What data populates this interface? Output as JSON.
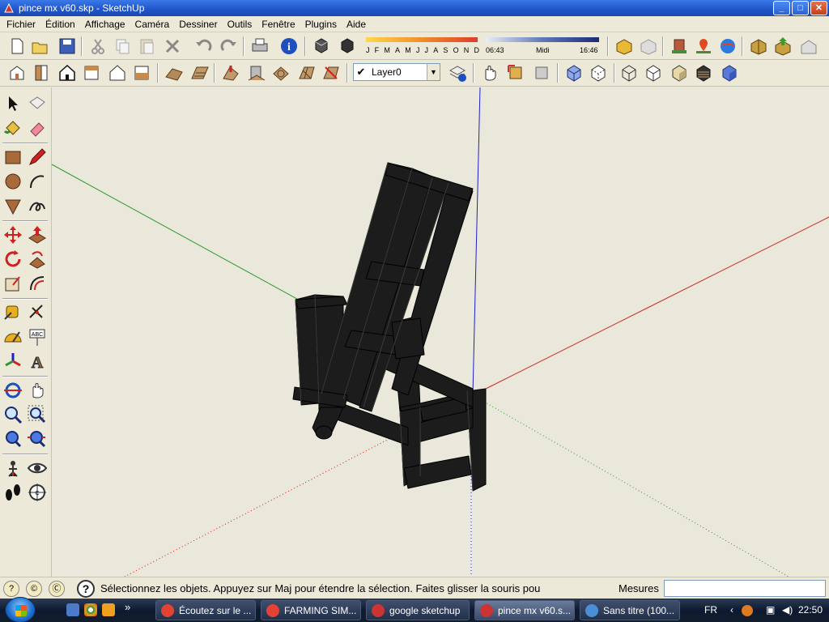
{
  "window": {
    "title": "pince mx v60.skp - SketchUp",
    "controls": [
      "_",
      "□",
      "✕"
    ]
  },
  "menu": [
    "Fichier",
    "Édition",
    "Affichage",
    "Caméra",
    "Dessiner",
    "Outils",
    "Fenêtre",
    "Plugins",
    "Aide"
  ],
  "shadow": {
    "months": [
      "J",
      "F",
      "M",
      "A",
      "M",
      "J",
      "J",
      "A",
      "S",
      "O",
      "N",
      "D"
    ],
    "time_start": "06:43",
    "time_mid": "Midi",
    "time_end": "16:46"
  },
  "layer": {
    "selected": "Layer0",
    "visible_check": "✔"
  },
  "status": {
    "message": "Sélectionnez les objets. Appuyez sur Maj pour étendre la sélection. Faites glisser la souris pou",
    "measure_label": "Mesures",
    "measure_value": "",
    "help_glyph": "?"
  },
  "taskbar": {
    "tasks": [
      {
        "label": "Écoutez sur le ...",
        "icon_color": "#e34234",
        "active": false
      },
      {
        "label": "FARMING SIM...",
        "icon_color": "#e34234",
        "active": false
      },
      {
        "label": "google sketchup",
        "icon_color": "#c33",
        "active": false
      },
      {
        "label": "pince mx v60.s...",
        "icon_color": "#c33",
        "active": true
      },
      {
        "label": "Sans titre (100...",
        "icon_color": "#4a8fd6",
        "active": false
      }
    ],
    "overflow": "»",
    "language": "FR",
    "clock": "22:50"
  },
  "colors": {
    "viewport_bg": "#e9e8da",
    "axis_red": "#d01818",
    "axis_green": "#2a9a2a",
    "axis_blue": "#2020c8",
    "model": "#1c1c1c"
  }
}
